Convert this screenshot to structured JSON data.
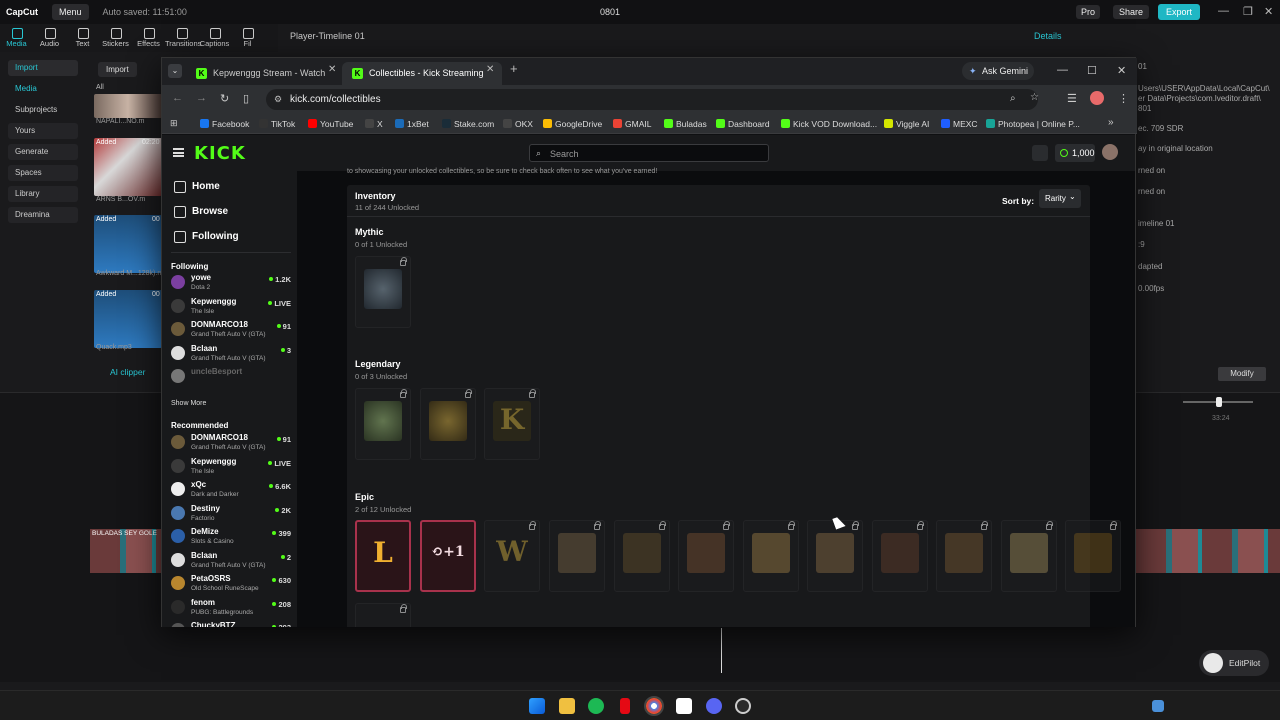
{
  "capcut": {
    "logo": "CapCut",
    "menu_label": "Menu",
    "auto_saved": "Auto saved: 11:51:00",
    "project_title": "0801",
    "pro_label": "Pro",
    "share_label": "Share",
    "export_label": "Export",
    "tools": [
      "Media",
      "Audio",
      "Text",
      "Stickers",
      "Effects",
      "Transitions",
      "Captions",
      "Fil"
    ],
    "sidebar": [
      "Import",
      "Media",
      "Subprojects",
      "Yours",
      "Generate",
      "Spaces",
      "Library",
      "Dreamina"
    ],
    "import_button": "Import",
    "media_all": "All",
    "media_items": [
      {
        "badge": "",
        "label": "NAPALI...NO.m"
      },
      {
        "badge": "Added",
        "duration": "02:20",
        "label": "ARNS B...OV.m"
      },
      {
        "badge": "Added",
        "duration": "00",
        "label": "Awkward M...128k).m"
      },
      {
        "badge": "Added",
        "duration": "00",
        "label": "Quack.mp3"
      }
    ],
    "proxy_label": "Proxy",
    "ai_clipper": "AI clipper",
    "player_title": "Player-Timeline 01",
    "details_title": "Details",
    "details_values": [
      "01",
      "Users\\USER\\AppData\\Local\\CapCut\\",
      "er Data\\Projects\\com.lveditor.draft\\",
      "801",
      "ec. 709 SDR",
      "ay in original location",
      "rned on",
      "rned on",
      "imeline 01",
      ":9",
      "dapted",
      "0.00fps"
    ],
    "modify_label": "Modify",
    "timeline_time": "33:24",
    "clip_label": "BULADAS SEY GOLE",
    "editpilot_label": "EditPilot"
  },
  "browser": {
    "tabs": [
      {
        "title": "Kepwenggg Stream - Watch",
        "active": false
      },
      {
        "title": "Collectibles - Kick Streaming",
        "active": true
      }
    ],
    "ask_gemini": "Ask Gemini",
    "url": "kick.com/collectibles",
    "bookmarks": [
      {
        "label": "Facebook",
        "color": "#1877f2"
      },
      {
        "label": "TikTok",
        "color": "#111111"
      },
      {
        "label": "YouTube",
        "color": "#ff0000"
      },
      {
        "label": "X",
        "color": "#000000"
      },
      {
        "label": "1xBet",
        "color": "#1b6bb8"
      },
      {
        "label": "Stake.com",
        "color": "#1a2c38"
      },
      {
        "label": "OKX",
        "color": "#000000"
      },
      {
        "label": "GoogleDrive",
        "color": "#fbbc04"
      },
      {
        "label": "GMAIL",
        "color": "#ea4335"
      },
      {
        "label": "Buladas",
        "color": "#53fc18"
      },
      {
        "label": "Dashboard",
        "color": "#53fc18"
      },
      {
        "label": "Kick VOD Download...",
        "color": "#53fc18"
      },
      {
        "label": "Viggle AI",
        "color": "#d4e600"
      },
      {
        "label": "MEXC",
        "color": "#1f5eff"
      },
      {
        "label": "Photopea | Online P...",
        "color": "#18a497"
      }
    ]
  },
  "kick": {
    "logo": "KICK",
    "search_placeholder": "Search",
    "coins": "1,000",
    "nav": [
      "Home",
      "Browse",
      "Following"
    ],
    "following_header": "Following",
    "following": [
      {
        "name": "yowe",
        "game": "Dota 2",
        "viewers": "1.2K",
        "avatar": "#7b3fa0",
        "offline": false
      },
      {
        "name": "Kepwenggg",
        "game": "The Isle",
        "viewers": "LIVE",
        "avatar": "#3a3a3a",
        "offline": false
      },
      {
        "name": "DONMARCO18",
        "game": "Grand Theft Auto V (GTA)",
        "viewers": "91",
        "avatar": "#6b5a3a",
        "offline": false
      },
      {
        "name": "Bclaan",
        "game": "Grand Theft Auto V (GTA)",
        "viewers": "3",
        "avatar": "#dddddd",
        "offline": false
      },
      {
        "name": "uncleBesport",
        "game": "",
        "viewers": "",
        "avatar": "#777777",
        "offline": true
      }
    ],
    "show_more": "Show More",
    "recommended_header": "Recommended",
    "recommended": [
      {
        "name": "DONMARCO18",
        "game": "Grand Theft Auto V (GTA)",
        "viewers": "91",
        "avatar": "#6b5a3a"
      },
      {
        "name": "Kepwenggg",
        "game": "The Isle",
        "viewers": "LIVE",
        "avatar": "#3a3a3a"
      },
      {
        "name": "xQc",
        "game": "Dark and Darker",
        "viewers": "6.6K",
        "avatar": "#eeeeee"
      },
      {
        "name": "Destiny",
        "game": "Factorio",
        "viewers": "2K",
        "avatar": "#4a78b0"
      },
      {
        "name": "DeMize",
        "game": "Slots & Casino",
        "viewers": "399",
        "avatar": "#2b5fa8"
      },
      {
        "name": "Bclaan",
        "game": "Grand Theft Auto V (GTA)",
        "viewers": "2",
        "avatar": "#dddddd"
      },
      {
        "name": "PetaOSRS",
        "game": "Old School RuneScape",
        "viewers": "630",
        "avatar": "#b8862e"
      },
      {
        "name": "fenom",
        "game": "PUBG: Battlegrounds",
        "viewers": "208",
        "avatar": "#2a2a2a"
      },
      {
        "name": "ChuckyBTZ",
        "game": "",
        "viewers": "293",
        "avatar": "#555555"
      }
    ],
    "intro_text": "to showcasing your unlocked collectibles, so be sure to check back often to see what you've earned!",
    "inventory_title": "Inventory",
    "inventory_sub": "11 of 244 Unlocked",
    "sort_by": "Sort by:",
    "sort_value": "Rarity",
    "tiers": [
      {
        "name": "Mythic",
        "sub": "0 of 1 Unlocked"
      },
      {
        "name": "Legendary",
        "sub": "0 of 3 Unlocked"
      },
      {
        "name": "Epic",
        "sub": "2 of 12 Unlocked"
      }
    ],
    "epic_glyphs": [
      "L",
      "⟲+1",
      "W"
    ]
  }
}
